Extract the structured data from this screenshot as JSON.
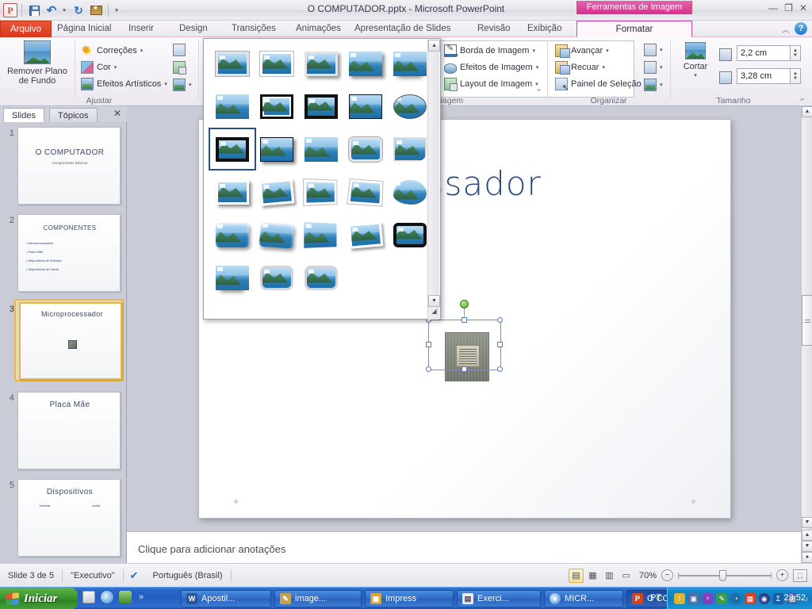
{
  "window": {
    "title": "O COMPUTADOR.pptx  -  Microsoft PowerPoint",
    "contextual_tab_label": "Ferramentas de Imagem",
    "minimize": "—",
    "restore": "❐",
    "close": "✕",
    "help": "?",
    "collapse_ribbon": "︿"
  },
  "quick_access": {
    "app_logo": "P",
    "save": "save-icon",
    "undo": "undo-icon",
    "undo_caret": "▾",
    "redo": "redo-icon",
    "slideshow": "slideshow-icon",
    "customize": "▾"
  },
  "tabs": [
    {
      "label": "Arquivo",
      "type": "file"
    },
    {
      "label": "Página Inicial",
      "type": "normal"
    },
    {
      "label": "Inserir",
      "type": "normal"
    },
    {
      "label": "Design",
      "type": "normal"
    },
    {
      "label": "Transições",
      "type": "normal"
    },
    {
      "label": "Animações",
      "type": "normal"
    },
    {
      "label": "Apresentação de Slides",
      "type": "normal"
    },
    {
      "label": "Revisão",
      "type": "normal"
    },
    {
      "label": "Exibição",
      "type": "normal"
    },
    {
      "label": "Formatar",
      "type": "contextual-active"
    }
  ],
  "ribbon": {
    "groups": [
      {
        "name": "Ajustar"
      },
      {
        "name": "Estilos de Imagem"
      },
      {
        "name": "Organizar"
      },
      {
        "name": "Tamanho"
      }
    ],
    "adjust": {
      "remove_background": "Remover Plano\nde Fundo",
      "remove_background_line1": "Remover Plano",
      "remove_background_line2": "de Fundo",
      "corrections": "Correções",
      "color": "Cor",
      "artistic_effects": "Efeitos Artísticos",
      "caret": "▾"
    },
    "picture_styles": {
      "picture_border": "Borda de Imagem",
      "picture_effects": "Efeitos de Imagem",
      "picture_layout": "Layout de Imagem",
      "caret": "▾",
      "dialog_launcher": "⌐"
    },
    "arrange": {
      "bring_forward": "Avançar",
      "send_backward": "Recuar",
      "selection_pane": "Painel de Seleção",
      "caret": "▾"
    },
    "size": {
      "crop_label": "Cortar",
      "crop_caret": "▾",
      "height_value": "2,2 cm",
      "width_value": "3,28 cm",
      "spin_up": "▲",
      "spin_down": "▼",
      "dialog_launcher": "⌐"
    }
  },
  "gallery_popup": {
    "scroll_up": "▲",
    "scroll_down": "▼",
    "resize_grip": "◢",
    "rows": [
      [
        {
          "name": "simple-frame-white",
          "frame": "fr-gray"
        },
        {
          "name": "beveled-matte-white",
          "frame": "fr-white"
        },
        {
          "name": "metal-frame",
          "frame": "fr-gray fr-shadow"
        },
        {
          "name": "drop-shadow-rectangle",
          "frame": "fr-shadow"
        },
        {
          "name": "reflected-rounded-rectangle",
          "frame": "fr-refl"
        }
      ],
      [
        {
          "name": "soft-edge-oval",
          "frame": "fr-soft"
        },
        {
          "name": "double-frame-black",
          "frame": "fr-blackwhite"
        },
        {
          "name": "thick-matte-black",
          "frame": "fr-black"
        },
        {
          "name": "simple-frame-black",
          "frame": "fr-thin-black"
        },
        {
          "name": "beveled-oval-black",
          "frame": "fr-oval"
        }
      ],
      [
        {
          "name": "compound-frame-black",
          "frame": "fr-black"
        },
        {
          "name": "moderate-frame-black",
          "frame": "fr-thin-black fr-shadow"
        },
        {
          "name": "center-shadow-rectangle",
          "frame": "fr-soft"
        },
        {
          "name": "rounded-diagonal-corner-white",
          "frame": "fr-round fr-gray"
        },
        {
          "name": "snip-diagonal-corner-white",
          "frame": "fr-cut"
        }
      ],
      [
        {
          "name": "moderate-frame-white",
          "frame": "fr-white fr-shadow"
        },
        {
          "name": "rotated-white",
          "frame": "fr-rot fr-white"
        },
        {
          "name": "perspective-shadow-white",
          "frame": "fr-persp fr-white"
        },
        {
          "name": "relaxed-perspective-white",
          "frame": "fr-rot2 fr-white"
        },
        {
          "name": "soft-edge-cloud",
          "frame": "fr-cloud fr-soft"
        }
      ],
      [
        {
          "name": "bevel-rectangle",
          "frame": "fr-bevel"
        },
        {
          "name": "bevel-perspective",
          "frame": "fr-rot2 fr-bevel"
        },
        {
          "name": "reflected-perspective-right",
          "frame": "fr-persp"
        },
        {
          "name": "perspective-relaxed-moderate",
          "frame": "fr-rot fr-white"
        },
        {
          "name": "bevel-perspective-left",
          "frame": "fr-black fr-round"
        }
      ],
      [
        {
          "name": "reflected-bevel-white",
          "frame": "fr-refl"
        },
        {
          "name": "reflected-bevel-black",
          "frame": "fr-roundfat"
        },
        {
          "name": "metal-oval",
          "frame": "fr-oval fr-roundfat"
        }
      ]
    ]
  },
  "slides_panel": {
    "tab_slides": "Slides",
    "tab_outline": "Tópicos",
    "close": "✕",
    "slides": [
      {
        "number": "1",
        "title": "O COMPUTADOR",
        "subtitle": "Componentes Básicos",
        "layout": "title"
      },
      {
        "number": "2",
        "title": "COMPONENTES",
        "bullets": [
          "Microprocessador",
          "Placa Mãe",
          "Dispositivos de Entrada",
          "Dispositivos de Saída"
        ],
        "layout": "bullets"
      },
      {
        "number": "3",
        "title": "Microprocessador",
        "layout": "image",
        "current": true
      },
      {
        "number": "4",
        "title": "Placa Mãe",
        "layout": "blank"
      },
      {
        "number": "5",
        "title": "Dispositivos",
        "col_left": "entrada",
        "col_right": "saída",
        "layout": "two-col"
      }
    ]
  },
  "slide_editor": {
    "title": "Microprocessador",
    "selected_object": "microprocessor-image"
  },
  "notes": {
    "placeholder": "Clique para adicionar anotações"
  },
  "status_bar": {
    "slide_counter": "Slide 3 de 5",
    "theme": "\"Executivo\"",
    "spellcheck_icon": "spellcheck-icon",
    "language": "Português (Brasil)",
    "view_normal": "▤",
    "view_sorter": "▦",
    "view_reading": "▥",
    "view_slideshow": "▭",
    "zoom_level": "70%",
    "zoom_out": "−",
    "zoom_in": "+",
    "fit_to_window": "⛶"
  },
  "taskbar": {
    "start_label": "Iniciar",
    "quick_launch_more": "»",
    "buttons": [
      {
        "label": "Apostil...",
        "app": "word",
        "mark": "W",
        "color": "#2a5699",
        "active": false
      },
      {
        "label": "image...",
        "app": "paint",
        "mark": "🖌",
        "color": "#c8a24a",
        "active": false
      },
      {
        "label": "Impress",
        "app": "impress",
        "mark": "▣",
        "color": "#d8a43c",
        "active": false
      },
      {
        "label": "Exerci...",
        "app": "document",
        "mark": "▤",
        "color": "#dcdce4",
        "active": false
      },
      {
        "label": "MICR...",
        "app": "ie",
        "mark": "e",
        "color": "#2f7fd0",
        "active": false
      },
      {
        "label": "O CO...",
        "app": "powerpoint",
        "mark": "P",
        "color": "#d04423",
        "active": true
      }
    ],
    "language_indicator": "PT",
    "clock": "23:52",
    "tray_icons": [
      "shield-icon",
      "network-icon",
      "vivo-icon",
      "pen-icon",
      "chrome-icon",
      "chart-icon",
      "disc-icon",
      "sigma-icon",
      "connection-icon",
      "sound-icon"
    ]
  },
  "colors": {
    "accent_pink": "#d6308e",
    "file_tab_red": "#d63a18",
    "slide_title_blue": "#2a4a7c",
    "selection_gold": "#e8b54a",
    "taskbar_blue": "#245ec0",
    "start_green": "#3f9a31"
  }
}
